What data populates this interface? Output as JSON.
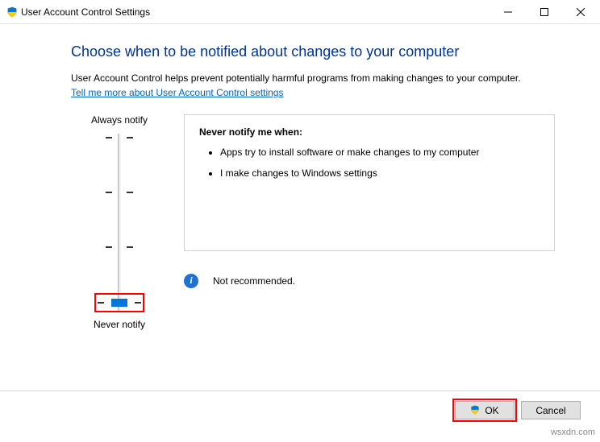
{
  "window": {
    "title": "User Account Control Settings"
  },
  "heading": "Choose when to be notified about changes to your computer",
  "description": "User Account Control helps prevent potentially harmful programs from making changes to your computer.",
  "link_text": "Tell me more about User Account Control settings",
  "slider": {
    "top_label": "Always notify",
    "bottom_label": "Never notify"
  },
  "panel": {
    "title": "Never notify me when:",
    "items": [
      "Apps try to install software or make changes to my computer",
      "I make changes to Windows settings"
    ]
  },
  "recommendation": "Not recommended.",
  "buttons": {
    "ok": "OK",
    "cancel": "Cancel"
  },
  "watermark": "wsxdn.com"
}
